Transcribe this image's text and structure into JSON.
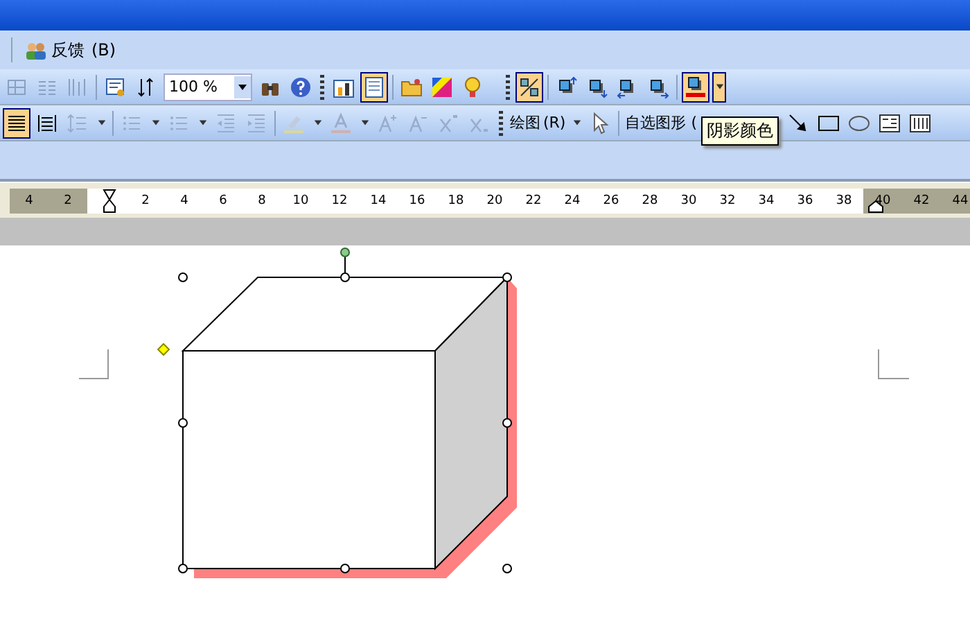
{
  "menu_bar": {
    "items": [
      {
        "label": "反馈",
        "access_key": "(B)"
      }
    ]
  },
  "toolbar_rows": [
    [
      {
        "kind": "table-grid",
        "pressed": false
      },
      {
        "kind": "columns",
        "pressed": false
      },
      {
        "kind": "sort-bars",
        "pressed": false
      },
      {
        "kind": "separator"
      },
      {
        "kind": "doc-view",
        "pressed": false
      },
      {
        "kind": "swap-arrows",
        "pressed": false
      },
      {
        "kind": "zoom-field",
        "value": "100 %"
      },
      {
        "kind": "binoculars",
        "pressed": false
      },
      {
        "kind": "help",
        "pressed": false
      },
      {
        "kind": "grip"
      },
      {
        "kind": "chart-doc",
        "pressed": false
      },
      {
        "kind": "page",
        "pressed": true
      },
      {
        "kind": "separator"
      },
      {
        "kind": "folder",
        "pressed": false
      },
      {
        "kind": "palette",
        "pressed": false
      },
      {
        "kind": "bulb",
        "pressed": false
      },
      {
        "kind": "gap"
      },
      {
        "kind": "grip"
      },
      {
        "kind": "shadow-toggle",
        "pressed": true
      },
      {
        "kind": "separator"
      },
      {
        "kind": "nudge-up",
        "pressed": false
      },
      {
        "kind": "nudge-down",
        "pressed": false
      },
      {
        "kind": "nudge-left",
        "pressed": false
      },
      {
        "kind": "nudge-right",
        "pressed": false
      },
      {
        "kind": "separator"
      },
      {
        "kind": "shadow-color",
        "pressed": true
      },
      {
        "kind": "dropdown",
        "pressed": true
      }
    ],
    [
      {
        "kind": "justify",
        "pressed": true
      },
      {
        "kind": "distribute",
        "pressed": false
      },
      {
        "kind": "line-spacing",
        "pressed": false
      },
      {
        "kind": "caret",
        "pressed": false
      },
      {
        "kind": "separator"
      },
      {
        "kind": "numbered-list",
        "pressed": false
      },
      {
        "kind": "caret",
        "pressed": false
      },
      {
        "kind": "bullet-list",
        "pressed": false
      },
      {
        "kind": "caret",
        "pressed": false
      },
      {
        "kind": "outdent",
        "pressed": false
      },
      {
        "kind": "indent",
        "pressed": false
      },
      {
        "kind": "separator"
      },
      {
        "kind": "highlight",
        "pressed": false
      },
      {
        "kind": "caret",
        "pressed": false
      },
      {
        "kind": "font-color",
        "pressed": false
      },
      {
        "kind": "caret",
        "pressed": false
      },
      {
        "kind": "grow-font",
        "pressed": false
      },
      {
        "kind": "shrink-font",
        "pressed": false
      },
      {
        "kind": "superscript",
        "pressed": false
      },
      {
        "kind": "subscript",
        "pressed": false
      },
      {
        "kind": "grip"
      },
      {
        "kind": "text-menu",
        "label": "绘图",
        "access_key": "(R)"
      },
      {
        "kind": "caret",
        "pressed": false
      },
      {
        "kind": "pointer",
        "pressed": false
      },
      {
        "kind": "separator"
      },
      {
        "kind": "text-menu",
        "label": "自选图形 ("
      },
      {
        "kind": "gap"
      },
      {
        "kind": "arrow",
        "pressed": false
      },
      {
        "kind": "rectangle",
        "pressed": false
      },
      {
        "kind": "ellipse",
        "pressed": false
      },
      {
        "kind": "textbox",
        "pressed": false
      },
      {
        "kind": "vertical-textbox",
        "pressed": false
      }
    ]
  ],
  "tooltip": {
    "text": "阴影颜色"
  },
  "ruler": {
    "ticks": [
      {
        "label": "4",
        "in_margin": true
      },
      {
        "label": "2",
        "in_margin": true
      },
      {
        "in_margin": false
      },
      {
        "label": "2",
        "in_margin": false
      },
      {
        "label": "4",
        "in_margin": false
      },
      {
        "label": "6",
        "in_margin": false
      },
      {
        "label": "8",
        "in_margin": false
      },
      {
        "label": "10",
        "in_margin": false
      },
      {
        "label": "12",
        "in_margin": false
      },
      {
        "label": "14",
        "in_margin": false
      },
      {
        "label": "16",
        "in_margin": false
      },
      {
        "label": "18",
        "in_margin": false
      },
      {
        "label": "20",
        "in_margin": false
      },
      {
        "label": "22",
        "in_margin": false
      },
      {
        "label": "24",
        "in_margin": false
      },
      {
        "label": "26",
        "in_margin": false
      },
      {
        "label": "28",
        "in_margin": false
      },
      {
        "label": "30",
        "in_margin": false
      },
      {
        "label": "32",
        "in_margin": false
      },
      {
        "label": "34",
        "in_margin": false
      },
      {
        "label": "36",
        "in_margin": false
      },
      {
        "label": "38",
        "in_margin": false
      },
      {
        "label": "40",
        "in_margin": true
      },
      {
        "label": "42",
        "in_margin": true
      },
      {
        "label": "44",
        "in_margin": true
      }
    ]
  },
  "shape": {
    "selected": true,
    "shadow": true
  }
}
